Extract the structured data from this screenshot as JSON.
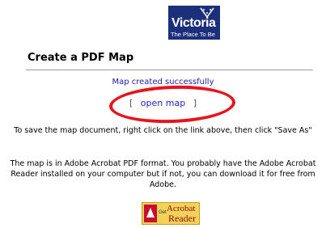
{
  "logo": {
    "word": "Victoria",
    "tagline": "The Place To Be"
  },
  "page": {
    "title": "Create a PDF Map"
  },
  "status": {
    "message": "Map created successfully"
  },
  "open_map": {
    "left_bracket": "[",
    "link_label": "open map",
    "right_bracket": "]"
  },
  "paragraphs": {
    "save_instructions": "To save the map document, right click on the link above, then click \"Save As\"",
    "acrobat_note": "The map is in Adobe Acrobat PDF format. You probably have the Adobe Acrobat Reader installed on your computer but if not, you can download it for free from Adobe."
  },
  "acrobat_badge": {
    "get": "Get",
    "word1": "Acrobat",
    "word2": "Reader",
    "brand": "Adobe"
  },
  "colors": {
    "highlight": "#e8141b",
    "link": "#2222cc",
    "logo_bg": "#1c2f7a"
  }
}
